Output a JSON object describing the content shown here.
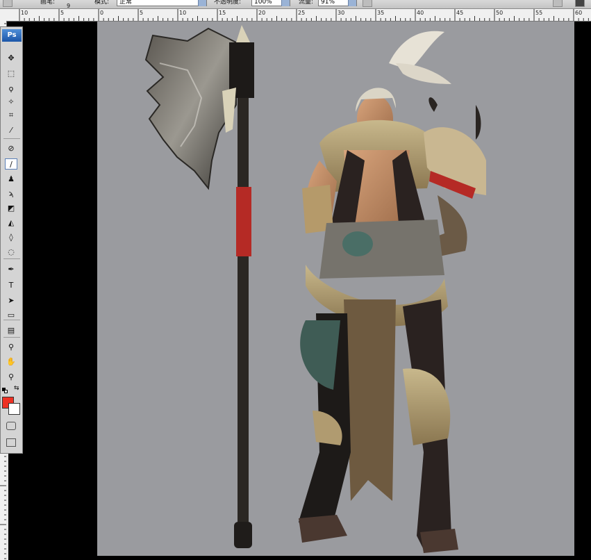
{
  "app": {
    "name": "Photoshop",
    "logo": "Ps"
  },
  "options_bar": {
    "brush_label": "画笔:",
    "brush_size": "9",
    "mode_label": "模式:",
    "mode_value": "正常",
    "opacity_label": "不透明度:",
    "opacity_value": "100%",
    "flow_label": "流量:",
    "flow_value": "91%"
  },
  "ruler": {
    "labels": [
      "10",
      "5",
      "0",
      "5",
      "10",
      "15",
      "20",
      "25",
      "30",
      "35",
      "40",
      "45",
      "50",
      "55",
      "60"
    ]
  },
  "toolbox": {
    "tools": [
      {
        "name": "move-tool",
        "icon": "move-icon",
        "glyph": "✥"
      },
      {
        "name": "marquee-tool",
        "icon": "marquee-icon",
        "glyph": "⬚"
      },
      {
        "name": "lasso-tool",
        "icon": "lasso-icon",
        "glyph": "ϙ"
      },
      {
        "name": "magic-wand-tool",
        "icon": "magic-wand-icon",
        "glyph": "✧"
      },
      {
        "name": "crop-tool",
        "icon": "crop-icon",
        "glyph": "⌗"
      },
      {
        "name": "slice-tool",
        "icon": "slice-icon",
        "glyph": "⁄"
      },
      {
        "name": "healing-brush-tool",
        "icon": "bandage-icon",
        "glyph": "⊘"
      },
      {
        "name": "brush-tool",
        "icon": "brush-icon",
        "glyph": "∕"
      },
      {
        "name": "clone-stamp-tool",
        "icon": "stamp-icon",
        "glyph": "♟"
      },
      {
        "name": "history-brush-tool",
        "icon": "history-brush-icon",
        "glyph": "ϡ"
      },
      {
        "name": "eraser-tool",
        "icon": "eraser-icon",
        "glyph": "◩"
      },
      {
        "name": "paint-bucket-tool",
        "icon": "bucket-icon",
        "glyph": "◭"
      },
      {
        "name": "blur-tool",
        "icon": "drop-icon",
        "glyph": "◊"
      },
      {
        "name": "dodge-tool",
        "icon": "dodge-icon",
        "glyph": "◌"
      },
      {
        "name": "pen-tool",
        "icon": "pen-icon",
        "glyph": "✒"
      },
      {
        "name": "type-tool",
        "icon": "type-icon",
        "glyph": "T"
      },
      {
        "name": "path-selection-tool",
        "icon": "arrow-icon",
        "glyph": "➤"
      },
      {
        "name": "shape-tool",
        "icon": "rectangle-icon",
        "glyph": "▭"
      },
      {
        "name": "notes-tool",
        "icon": "note-icon",
        "glyph": "▤"
      },
      {
        "name": "eyedropper-tool",
        "icon": "eyedropper-icon",
        "glyph": "⚲"
      },
      {
        "name": "hand-tool",
        "icon": "hand-icon",
        "glyph": "✋"
      },
      {
        "name": "zoom-tool",
        "icon": "zoom-icon",
        "glyph": "⚲"
      }
    ],
    "foreground_color": "#ee3124",
    "background_color": "#ffffff"
  },
  "colors": {
    "canvas_bg": "#9a9b9f",
    "workspace": "#000000"
  }
}
